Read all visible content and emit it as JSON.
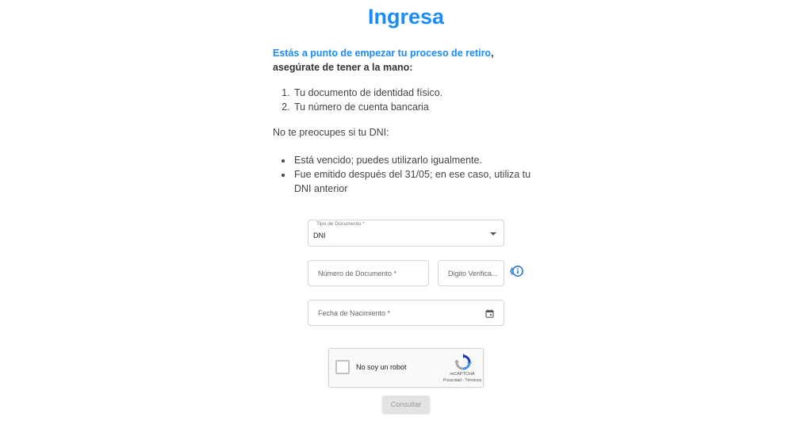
{
  "header": {
    "title": "Ingresa"
  },
  "intro": {
    "highlight": "Estás a punto de empezar tu proceso de retiro",
    "rest": ", asegúrate de tener a la mano:"
  },
  "requirements": [
    "Tu documento de identidad físico.",
    "Tu número de cuenta bancaria"
  ],
  "dni_note": "No te preocupes si tu DNI:",
  "dni_conditions": [
    "Está vencido; puedes utilizarlo igualmente.",
    "Fue emitido después del 31/05; en ese caso, utiliza tu DNI anterior"
  ],
  "form": {
    "doc_type": {
      "label": "Tipo de Documento *",
      "value": "DNI"
    },
    "doc_number": {
      "placeholder": "Número de Documento *"
    },
    "check_digit": {
      "placeholder": "Digito Verifica..."
    },
    "birth_date": {
      "placeholder": "Fecha de Nacimiento *"
    },
    "submit_label": "Consultar"
  },
  "captcha": {
    "label": "No soy un robot",
    "brand": "reCAPTCHA",
    "links": "Privacidad - Términos"
  },
  "icons": {
    "info": "info-icon",
    "calendar": "calendar-icon",
    "dropdown": "chevron-down-icon",
    "recaptcha": "recaptcha-logo-icon"
  },
  "colors": {
    "accent": "#1a8cff",
    "text": "#333333",
    "button_disabled": "#e3e3e3"
  }
}
